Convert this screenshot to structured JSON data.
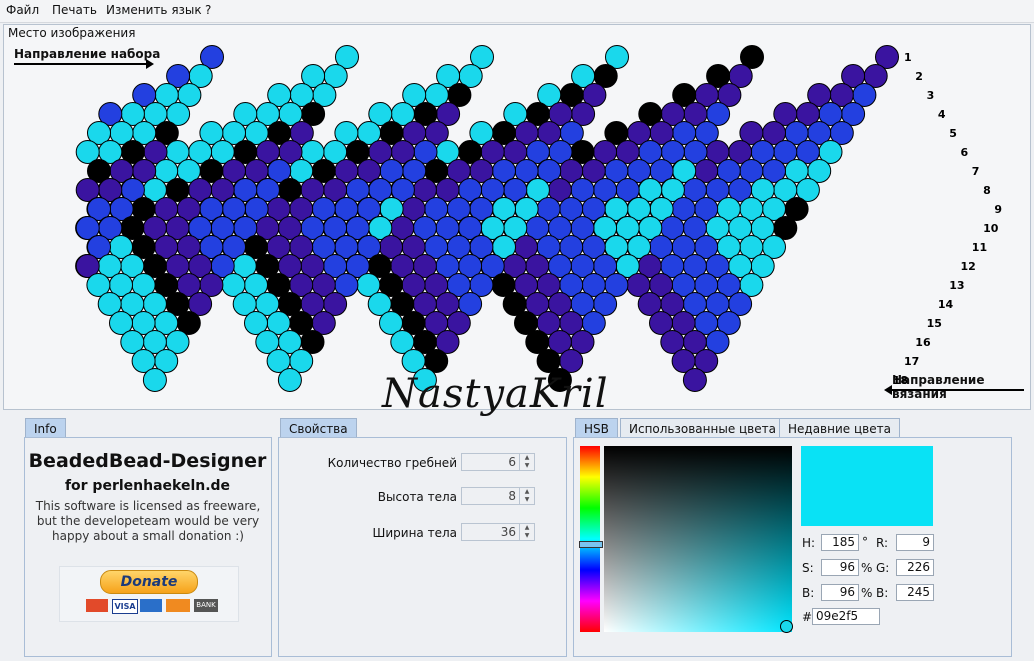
{
  "menu": [
    "Файл",
    "Печать",
    "Изменить язык",
    "?"
  ],
  "canvas": {
    "title": "Место изображения",
    "direction_set": "Направление набора",
    "direction_knit": "Направление вязания",
    "signature": "NastyaKril",
    "row_numbers": [
      "1",
      "2",
      "3",
      "4",
      "5",
      "6",
      "7",
      "8",
      "9",
      "10",
      "11",
      "12",
      "13",
      "14",
      "15",
      "16",
      "17",
      "18"
    ],
    "colors": {
      "light": "#1ad8ec",
      "blue": "#2340e0",
      "purple": "#3a14a0",
      "black": "#000000"
    }
  },
  "info": {
    "tab": "Info",
    "title": "BeadedBead-Designer",
    "subtitle": "for perlenhaekeln.de",
    "text": "This software is licensed as freeware, but the developeteam would be very happy about a small donation :)",
    "donate": "Donate",
    "cards": [
      "VISA",
      "BANK"
    ]
  },
  "props": {
    "tab": "Свойства",
    "items": [
      {
        "label": "Количество гребней",
        "value": "6"
      },
      {
        "label": "Высота тела",
        "value": "8"
      },
      {
        "label": "Ширина тела",
        "value": "36"
      }
    ]
  },
  "color": {
    "tabs": [
      "HSB",
      "Использованные цвета",
      "Недавние цвета"
    ],
    "selected_hex_color": "#09e2f5",
    "h": "185",
    "s": "96",
    "b": "96",
    "r": "9",
    "g": "226",
    "b2": "245",
    "hex": "09e2f5",
    "degree": "°",
    "pct": "%",
    "hash": "#",
    "labels": {
      "h": "H:",
      "s": "S:",
      "b": "B:",
      "r": "R:",
      "g": "G:",
      "bb": "B:"
    }
  }
}
